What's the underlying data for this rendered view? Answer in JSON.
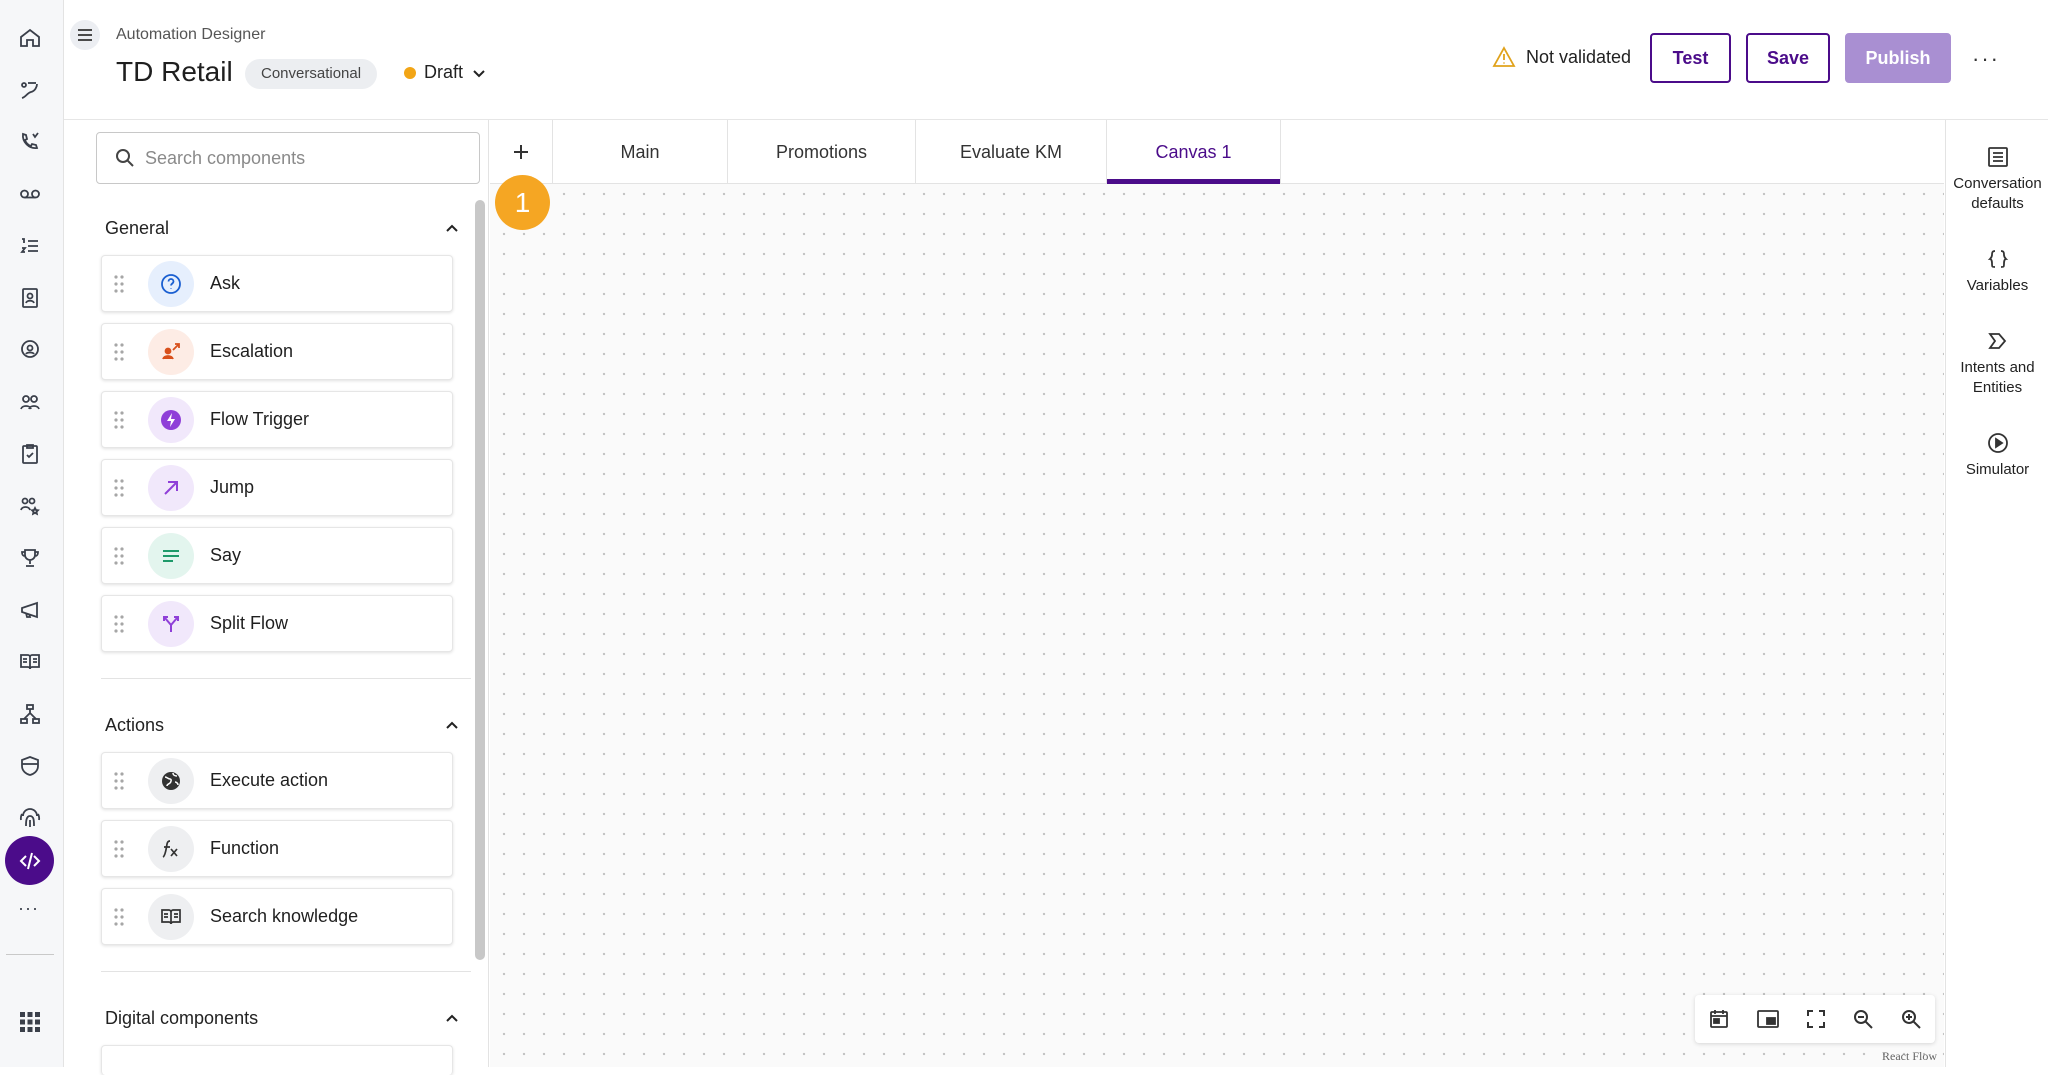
{
  "header": {
    "app_title": "Automation Designer",
    "project_name": "TD Retail",
    "type_badge": "Conversational",
    "status": "Draft",
    "status_color": "#f2a516",
    "validation": "Not validated",
    "test_label": "Test",
    "save_label": "Save",
    "publish_label": "Publish",
    "more_label": "···"
  },
  "rail": {
    "more_label": "···"
  },
  "panel": {
    "search_placeholder": "Search components",
    "sections": [
      {
        "title": "General",
        "items": [
          {
            "label": "Ask",
            "icon": "help-circle-icon"
          },
          {
            "label": "Escalation",
            "icon": "escalation-icon"
          },
          {
            "label": "Flow Trigger",
            "icon": "bolt-icon"
          },
          {
            "label": "Jump",
            "icon": "arrow-up-right-icon"
          },
          {
            "label": "Say",
            "icon": "text-lines-icon"
          },
          {
            "label": "Split Flow",
            "icon": "split-icon"
          }
        ]
      },
      {
        "title": "Actions",
        "items": [
          {
            "label": "Execute action",
            "icon": "globe-icon"
          },
          {
            "label": "Function",
            "icon": "function-icon"
          },
          {
            "label": "Search knowledge",
            "icon": "book-icon"
          }
        ]
      },
      {
        "title": "Digital components",
        "items": []
      }
    ]
  },
  "tabs": [
    {
      "label": "Main",
      "active": false
    },
    {
      "label": "Promotions",
      "active": false
    },
    {
      "label": "Evaluate KM",
      "active": false
    },
    {
      "label": "Canvas 1",
      "active": true
    }
  ],
  "canvas": {
    "step_badge": "1",
    "attribution": "React Flow"
  },
  "right_panel": [
    {
      "label": "Conversation defaults",
      "icon": "list-icon"
    },
    {
      "label": "Variables",
      "icon": "braces-icon"
    },
    {
      "label": "Intents and Entities",
      "icon": "intent-icon"
    },
    {
      "label": "Simulator",
      "icon": "play-circle-icon"
    }
  ],
  "colors": {
    "accent": "#4b0c8a",
    "publish_disabled": "#a98fd2",
    "badge": "#f5a623"
  }
}
